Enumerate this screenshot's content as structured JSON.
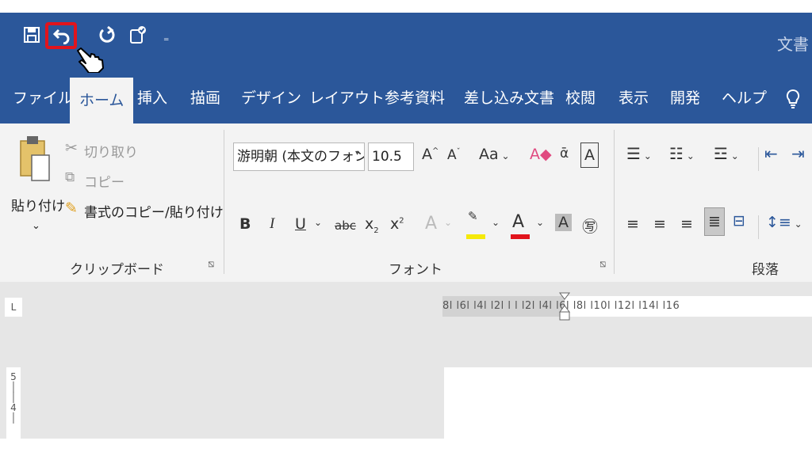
{
  "document": {
    "title": "文書"
  },
  "qat": {
    "save_icon": "save-icon",
    "undo_icon": "undo-icon",
    "redo_icon": "redo-icon",
    "touch_icon": "touch-mode-icon",
    "customize_icon": "customize-qat-icon",
    "undo_highlight_color": "#e1141c"
  },
  "tabs": [
    {
      "label": "ファイル"
    },
    {
      "label": "ホーム",
      "active": true
    },
    {
      "label": "挿入"
    },
    {
      "label": "描画"
    },
    {
      "label": "デザイン"
    },
    {
      "label": "レイアウト"
    },
    {
      "label": "参考資料"
    },
    {
      "label": "差し込み文書"
    },
    {
      "label": "校閲"
    },
    {
      "label": "表示"
    },
    {
      "label": "開発"
    },
    {
      "label": "ヘルプ"
    }
  ],
  "clipboard": {
    "paste_label": "貼り付け",
    "cut_label": "切り取り",
    "copy_label": "コピー",
    "format_painter_label": "書式のコピー/貼り付け",
    "group_name": "クリップボード"
  },
  "font": {
    "font_name": "游明朝 (本文のフォン",
    "font_size": "10.5",
    "aa_label": "Aa",
    "group_name": "フォント",
    "bold": "B",
    "italic": "I",
    "underline": "U",
    "strike": "abc",
    "subscript": "x",
    "superscript": "x",
    "font_color_bar": "#e1141c",
    "highlight_bar": "#f5e90a"
  },
  "paragraph": {
    "group_name": "段落"
  },
  "ruler": {
    "h_marks": "8l  l6l  l4l  l2l  l  l  l2l  l4l  l6l  l8l  l10l  l12l  l14l  l16",
    "v_marks": "5\n│\n│\n4\n│",
    "corner": "L"
  },
  "colors": {
    "brand": "#2b579a",
    "ribbon": "#f3f3f3",
    "canvas": "#e6e6e6"
  }
}
